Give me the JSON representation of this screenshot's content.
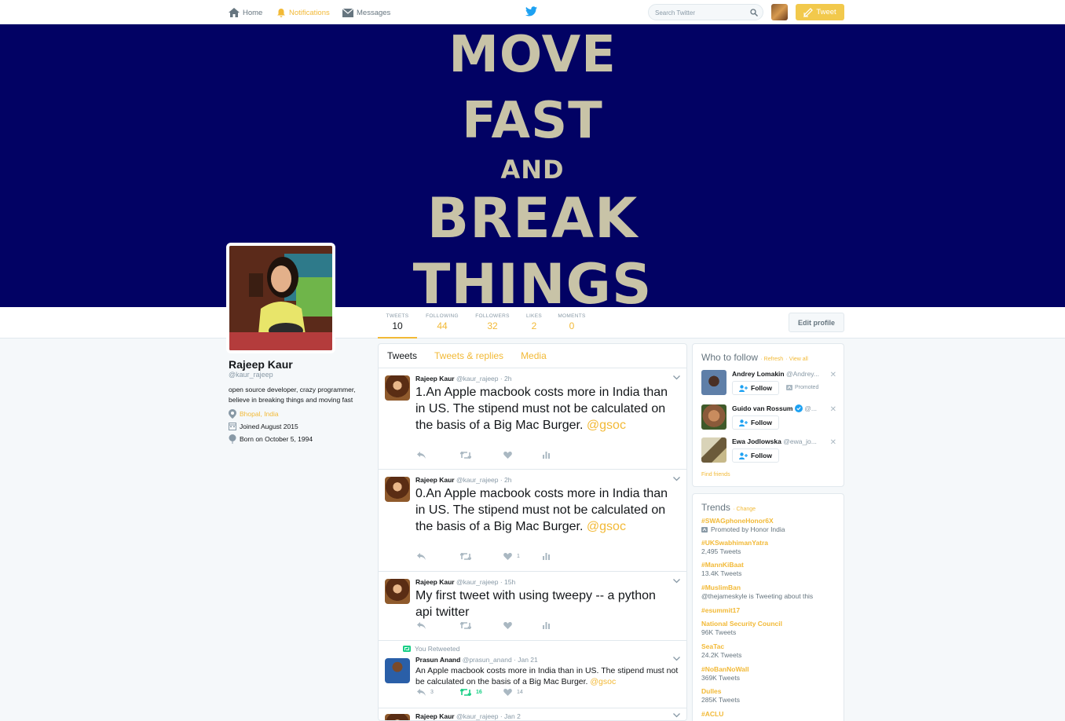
{
  "nav": {
    "home": "Home",
    "notifications": "Notifications",
    "messages": "Messages",
    "search_placeholder": "Search Twitter",
    "tweet_button": "Tweet"
  },
  "banner": {
    "lines": [
      "MOVE",
      "FAST",
      "AND",
      "BREAK",
      "THINGS"
    ]
  },
  "stats": [
    {
      "label": "TWEETS",
      "value": "10"
    },
    {
      "label": "FOLLOWING",
      "value": "44"
    },
    {
      "label": "FOLLOWERS",
      "value": "32"
    },
    {
      "label": "LIKES",
      "value": "2"
    },
    {
      "label": "MOMENTS",
      "value": "0"
    }
  ],
  "edit_profile": "Edit profile",
  "profile": {
    "name": "Rajeep Kaur",
    "handle": "@kaur_rajeep",
    "bio": "open source developer, crazy programmer, believe in breaking things and moving fast",
    "location": "Bhopal, India",
    "joined": "Joined August 2015",
    "born": "Born on October 5, 1994"
  },
  "tabs": [
    "Tweets",
    "Tweets & replies",
    "Media"
  ],
  "tweets": [
    {
      "name": "Rajeep Kaur",
      "meta": "@kaur_rajeep · 2h",
      "text": "1.An Apple macbook costs more in India than in US. The stipend must not be calculated on the basis of a Big Mac Burger.",
      "mention": "@gsoc",
      "likes": ""
    },
    {
      "name": "Rajeep Kaur",
      "meta": "@kaur_rajeep · 2h",
      "text": "0.An Apple macbook costs more in India than in US. The stipend must not be calculated on the basis of a Big Mac Burger.",
      "mention": "@gsoc",
      "likes": "1"
    },
    {
      "name": "Rajeep Kaur",
      "meta": "@kaur_rajeep · 15h",
      "text": "My first tweet with using tweepy -- a python api twitter",
      "mention": "",
      "likes": ""
    },
    {
      "context": "You Retweeted",
      "name": "Prasun Anand",
      "meta": "@prasun_anand · Jan 21",
      "text": "An Apple macbook costs more in India than in US. The stipend must not be calculated on the basis of a Big Mac Burger.",
      "mention": "@gsoc",
      "replies": "3",
      "retweets": "16",
      "likes": "14"
    },
    {
      "name": "Rajeep Kaur",
      "meta": "@kaur_rajeep · Jan 2"
    }
  ],
  "who_to_follow": {
    "title": "Who to follow",
    "refresh": "Refresh",
    "view_all": "View all",
    "follow_label": "Follow",
    "promoted": "Promoted",
    "find_friends": "Find friends",
    "users": [
      {
        "name": "Andrey Lomakin",
        "handle": "@Andrey..."
      },
      {
        "name": "Guido van Rossum",
        "handle": "@..."
      },
      {
        "name": "Ewa Jodlowska",
        "handle": "@ewa_jo..."
      }
    ]
  },
  "trends": {
    "title": "Trends",
    "change": "Change",
    "items": [
      {
        "name": "#SWAGphoneHonor6X",
        "sub": "Promoted by Honor India"
      },
      {
        "name": "#UKSwabhimanYatra",
        "sub": "2,495 Tweets"
      },
      {
        "name": "#MannKiBaat",
        "sub": "13.4K Tweets"
      },
      {
        "name": "#MuslimBan",
        "sub": "@thejameskyle is Tweeting about this"
      },
      {
        "name": "#esummit17",
        "sub": ""
      },
      {
        "name": "National Security Council",
        "sub": "96K Tweets"
      },
      {
        "name": "SeaTac",
        "sub": "24.2K Tweets"
      },
      {
        "name": "#NoBanNoWall",
        "sub": "369K Tweets"
      },
      {
        "name": "Dulles",
        "sub": "285K Tweets"
      },
      {
        "name": "#ACLU",
        "sub": ""
      }
    ]
  },
  "colors": {
    "accent": "#f2b936",
    "banner": "#020264",
    "retweet": "#19cf86"
  }
}
